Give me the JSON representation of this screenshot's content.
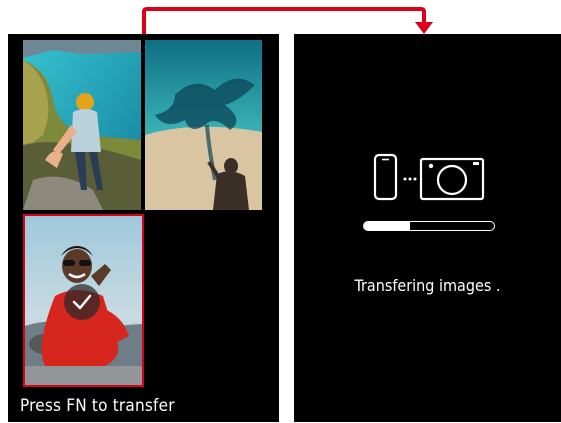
{
  "gallery": {
    "footer_label": "Press FN to transfer",
    "selected_index": 2,
    "thumbnails": [
      {
        "description_icon": "coastal-cliff-photo-icon"
      },
      {
        "description_icon": "beach-shadow-photo-icon"
      },
      {
        "description_icon": "smiling-woman-photo-icon"
      }
    ]
  },
  "transfer": {
    "status_label": "Transfering images .",
    "progress_fraction": 0.35,
    "icons": [
      "smartphone-icon",
      "dots-icon",
      "camera-icon"
    ]
  },
  "colors": {
    "arrow": "#d8001a",
    "selection": "#d8001a",
    "screen_bg": "#000000",
    "text": "#ffffff"
  }
}
